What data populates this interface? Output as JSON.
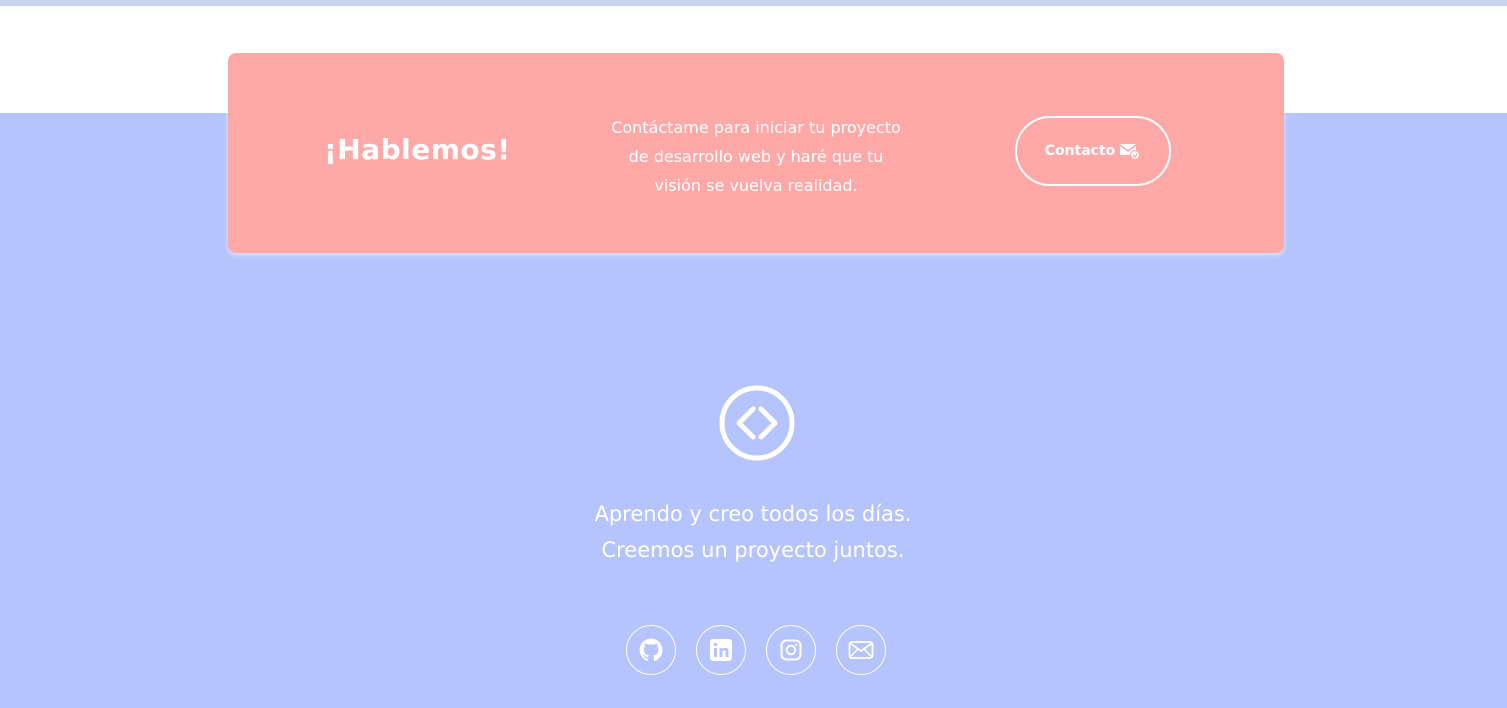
{
  "cta": {
    "title": "¡Hablemos!",
    "text_lines": [
      "Contáctame para iniciar tu proyecto",
      "de desarrollo web y haré que tu",
      "visión se vuelva realidad."
    ],
    "button_label": "Contacto",
    "button_icon": "mail-send-icon",
    "background_color": "#ffa8a8"
  },
  "footer": {
    "logo_icon": "code-brackets-icon",
    "tagline_lines": [
      "Aprendo y creo todos los días.",
      "Creemos un proyecto juntos."
    ],
    "background_color": "#b5c4fc",
    "social_links": [
      {
        "icon": "github-icon"
      },
      {
        "icon": "linkedin-icon"
      },
      {
        "icon": "instagram-icon"
      },
      {
        "icon": "email-icon"
      }
    ]
  }
}
